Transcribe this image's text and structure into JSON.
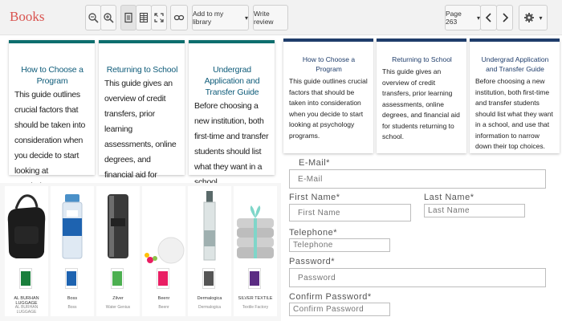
{
  "toolbar": {
    "brand": "Books",
    "add_to_library": "Add to my library",
    "write_review": "Write review",
    "page": "Page 263"
  },
  "guides_left": [
    {
      "title": "How to Choose a Program",
      "desc": "This guide outlines crucial factors that should be taken into consideration when you decide to start looking at psychology programs."
    },
    {
      "title": "Returning to School",
      "desc": "This guide gives an overview of credit transfers, prior learning assessments, online degrees, and financial aid for students returning to school."
    },
    {
      "title": "Undergrad Application and Transfer Guide",
      "desc": "Before choosing a new institution, both first-time and transfer students should list what they want in a school"
    }
  ],
  "guides_right": [
    {
      "title": "How to Choose a Program",
      "desc": "This guide outlines crucial factors that should be taken into consideration when you decide to start looking at psychology programs."
    },
    {
      "title": "Returning to School",
      "desc": "This guide gives an overview of credit transfers, prior learning assessments, online degrees, and financial aid for students returning to school."
    },
    {
      "title": "Undergrad Application and Transfer Guide",
      "desc": "Before choosing a new institution, both first-time and transfer students should list what they want in a school, and use that information to narrow down their top choices."
    }
  ],
  "products": [
    {
      "name": "AL BURHAN LUGGAGE",
      "sub": "AL BURHAN LUGGAGE",
      "logo_color": "#1a7f3c"
    },
    {
      "name": "Boss",
      "sub": "Boss",
      "logo_color": "#1e63b0"
    },
    {
      "name": "Zilver",
      "sub": "Water Genius",
      "logo_color": "#4caf50"
    },
    {
      "name": "Beenr",
      "sub": "Beenr",
      "logo_color": "#e91e63"
    },
    {
      "name": "Dermalogica",
      "sub": "Dermalogica",
      "logo_color": "#555555"
    },
    {
      "name": "SILVER TEXTILE",
      "sub": "Textile Factory",
      "logo_color": "#5b2c83"
    }
  ],
  "form": {
    "email_label": "E-Mail*",
    "email_placeholder": "E-Mail",
    "first_name_label": "First Name*",
    "first_name_placeholder": "First Name",
    "last_name_label": "Last Name*",
    "last_name_placeholder": "Last Name",
    "telephone_label": "Telephone*",
    "telephone_placeholder": "Telephone",
    "password_label": "Password*",
    "password_placeholder": "Password",
    "confirm_label": "Confirm Password*",
    "confirm_placeholder": "Confirm Password"
  }
}
